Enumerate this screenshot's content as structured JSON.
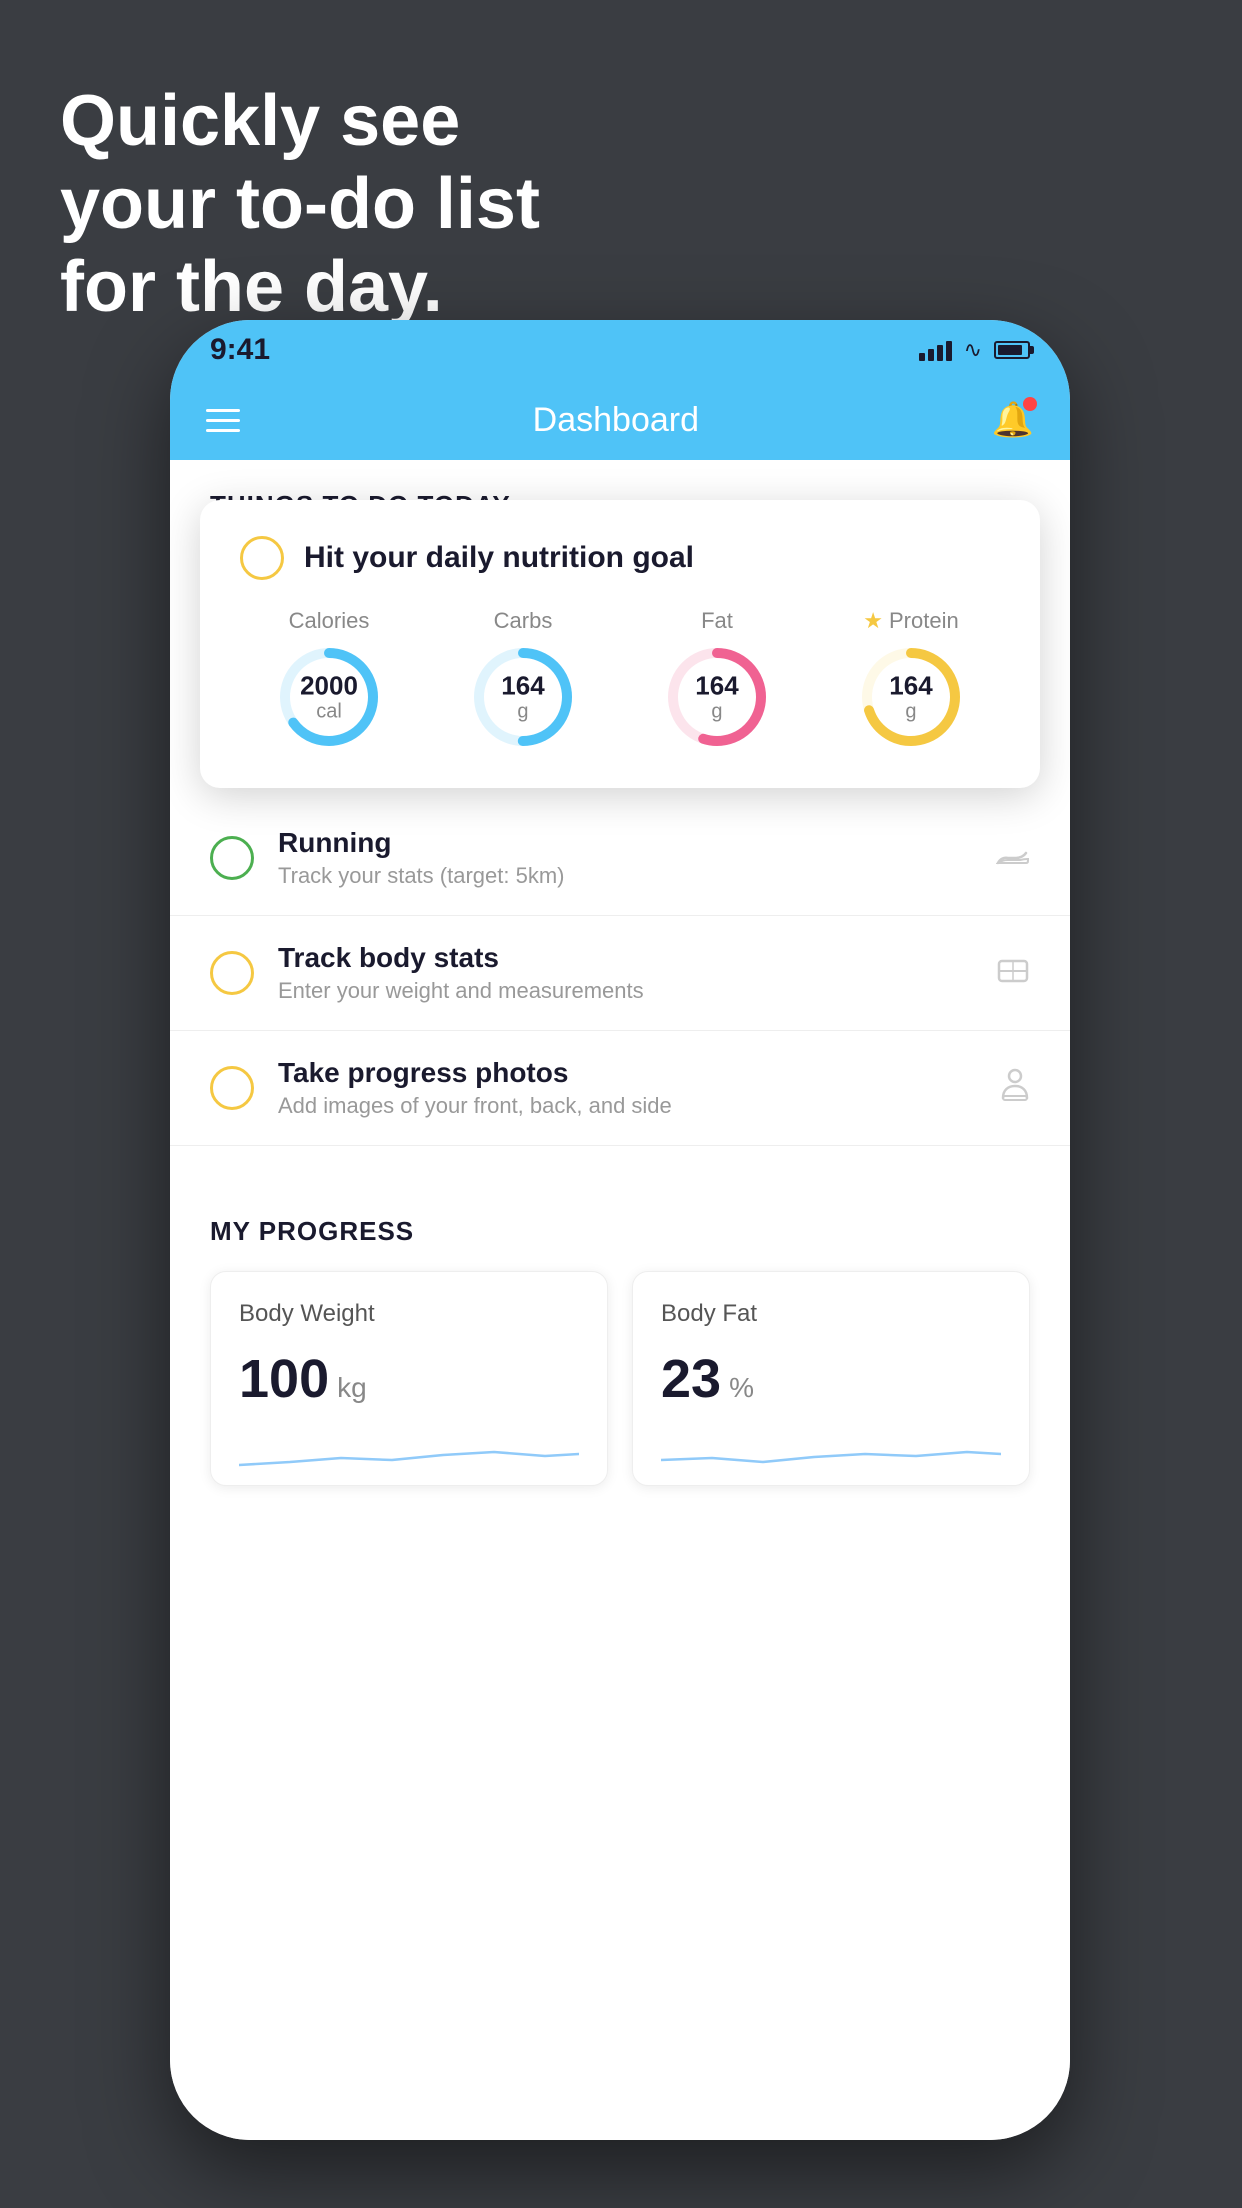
{
  "headline": {
    "line1": "Quickly see",
    "line2": "your to-do list",
    "line3": "for the day."
  },
  "statusBar": {
    "time": "9:41"
  },
  "navBar": {
    "title": "Dashboard"
  },
  "thingsToDoSection": {
    "title": "THINGS TO DO TODAY"
  },
  "nutritionCard": {
    "checkboxState": "unchecked",
    "title": "Hit your daily nutrition goal",
    "macros": [
      {
        "label": "Calories",
        "value": "2000",
        "unit": "cal",
        "color": "#4fc3f7",
        "percent": 65,
        "hasStar": false
      },
      {
        "label": "Carbs",
        "value": "164",
        "unit": "g",
        "color": "#4fc3f7",
        "percent": 50,
        "hasStar": false
      },
      {
        "label": "Fat",
        "value": "164",
        "unit": "g",
        "color": "#f06292",
        "percent": 55,
        "hasStar": false
      },
      {
        "label": "Protein",
        "value": "164",
        "unit": "g",
        "color": "#f5c842",
        "percent": 70,
        "hasStar": true
      }
    ]
  },
  "todoItems": [
    {
      "id": "running",
      "title": "Running",
      "subtitle": "Track your stats (target: 5km)",
      "circleColor": "green",
      "icon": "shoe"
    },
    {
      "id": "body-stats",
      "title": "Track body stats",
      "subtitle": "Enter your weight and measurements",
      "circleColor": "yellow",
      "icon": "scale"
    },
    {
      "id": "progress-photos",
      "title": "Take progress photos",
      "subtitle": "Add images of your front, back, and side",
      "circleColor": "yellow",
      "icon": "person"
    }
  ],
  "progressSection": {
    "title": "MY PROGRESS",
    "cards": [
      {
        "id": "body-weight",
        "title": "Body Weight",
        "value": "100",
        "unit": "kg"
      },
      {
        "id": "body-fat",
        "title": "Body Fat",
        "value": "23",
        "unit": "%"
      }
    ]
  }
}
